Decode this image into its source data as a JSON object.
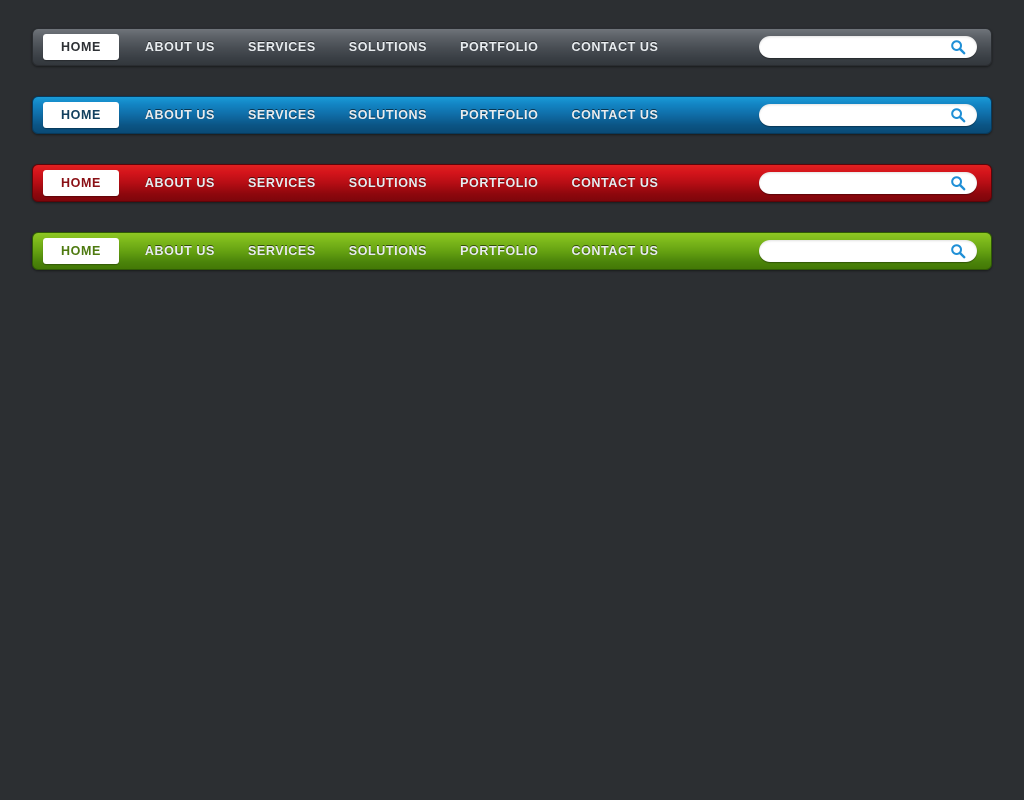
{
  "page": {
    "background_color": "#2c2f32"
  },
  "search": {
    "value": "",
    "placeholder": "",
    "icon": "search-icon",
    "icon_color": "#1f8fd6"
  },
  "menu_items": [
    {
      "label": "HOME",
      "active": true
    },
    {
      "label": "ABOUT US",
      "active": false
    },
    {
      "label": "SERVICES",
      "active": false
    },
    {
      "label": "SOLUTIONS",
      "active": false
    },
    {
      "label": "PORTFOLIO",
      "active": false
    },
    {
      "label": "CONTACT US",
      "active": false
    }
  ],
  "bars": [
    {
      "id": "graphite",
      "name": "graphite-navbar",
      "accent_color": "#5c6167",
      "active_label_color": "#2e3135",
      "items": [
        {
          "label": "HOME",
          "active": true
        },
        {
          "label": "ABOUT US",
          "active": false
        },
        {
          "label": "SERVICES",
          "active": false
        },
        {
          "label": "SOLUTIONS",
          "active": false
        },
        {
          "label": "PORTFOLIO",
          "active": false
        },
        {
          "label": "CONTACT US",
          "active": false
        }
      ],
      "search": {
        "value": "",
        "placeholder": ""
      }
    },
    {
      "id": "blue",
      "name": "blue-navbar",
      "accent_color": "#1385c4",
      "active_label_color": "#12405f",
      "items": [
        {
          "label": "HOME",
          "active": true
        },
        {
          "label": "ABOUT US",
          "active": false
        },
        {
          "label": "SERVICES",
          "active": false
        },
        {
          "label": "SOLUTIONS",
          "active": false
        },
        {
          "label": "PORTFOLIO",
          "active": false
        },
        {
          "label": "CONTACT US",
          "active": false
        }
      ],
      "search": {
        "value": "",
        "placeholder": ""
      }
    },
    {
      "id": "red",
      "name": "red-navbar",
      "accent_color": "#c1121a",
      "active_label_color": "#8a1015",
      "items": [
        {
          "label": "HOME",
          "active": true
        },
        {
          "label": "ABOUT US",
          "active": false
        },
        {
          "label": "SERVICES",
          "active": false
        },
        {
          "label": "SOLUTIONS",
          "active": false
        },
        {
          "label": "PORTFOLIO",
          "active": false
        },
        {
          "label": "CONTACT US",
          "active": false
        }
      ],
      "search": {
        "value": "",
        "placeholder": ""
      }
    },
    {
      "id": "green",
      "name": "green-navbar",
      "accent_color": "#77b41a",
      "active_label_color": "#4e7a10",
      "items": [
        {
          "label": "HOME",
          "active": true
        },
        {
          "label": "ABOUT US",
          "active": false
        },
        {
          "label": "SERVICES",
          "active": false
        },
        {
          "label": "SOLUTIONS",
          "active": false
        },
        {
          "label": "PORTFOLIO",
          "active": false
        },
        {
          "label": "CONTACT US",
          "active": false
        }
      ],
      "search": {
        "value": "",
        "placeholder": ""
      }
    }
  ]
}
